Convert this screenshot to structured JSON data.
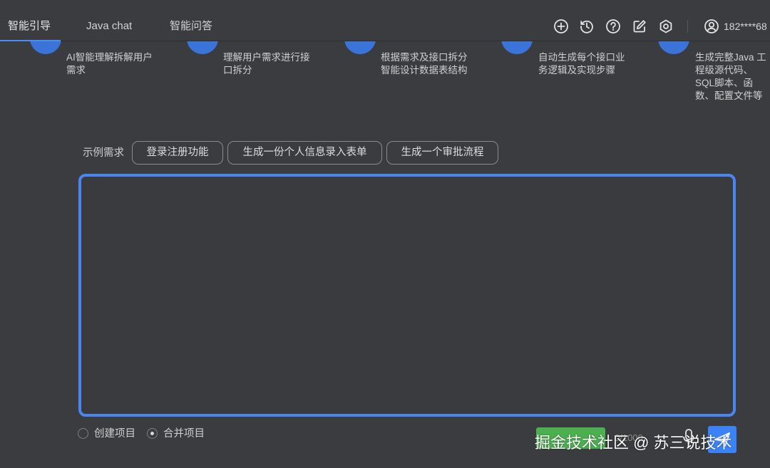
{
  "header": {
    "tabs": [
      {
        "label": "智能引导",
        "active": true
      },
      {
        "label": "Java chat",
        "active": false
      },
      {
        "label": "智能问答",
        "active": false
      }
    ],
    "icons": [
      "plus-circle-icon",
      "history-icon",
      "help-icon",
      "edit-icon",
      "settings-icon",
      "user-icon"
    ],
    "user_masked": "182****68"
  },
  "steps": [
    {
      "text": "AI智能理解拆解用户需求"
    },
    {
      "text": "理解用户需求进行接口拆分"
    },
    {
      "text": "根据需求及接口拆分智能设计数据表结构"
    },
    {
      "text": "自动生成每个接口业务逻辑及实现步骤"
    },
    {
      "text": "生成完整Java 工程级源代码、SQL脚本、函数、配置文件等"
    }
  ],
  "examples": {
    "label": "示例需求",
    "chips": [
      "登录注册功能",
      "生成一份个人信息录入表单",
      "生成一个审批流程"
    ]
  },
  "editor": {
    "value": ""
  },
  "project_mode": {
    "options": [
      {
        "label": "创建项目",
        "checked": false
      },
      {
        "label": "合并项目",
        "checked": true
      }
    ]
  },
  "footer": {
    "counter": "0/1000",
    "watermark": "掘金技术社区 @ 苏三说技术"
  },
  "colors": {
    "background": "#3b3c3f",
    "accent": "#4b85ef",
    "step_dot": "#3b74d9",
    "green_button": "#4caf50",
    "send_button": "#3b82f6"
  }
}
